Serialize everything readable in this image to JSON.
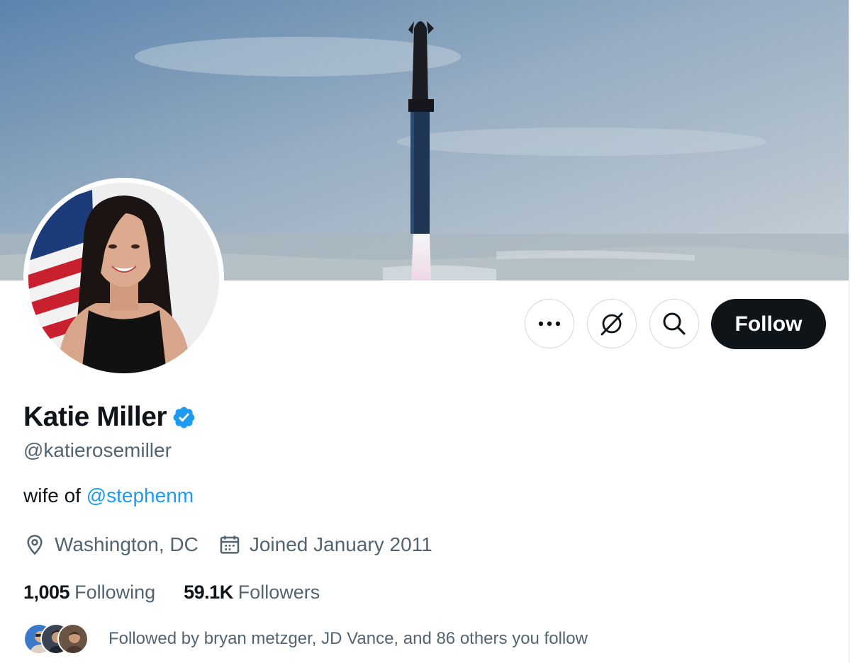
{
  "profile": {
    "display_name": "Katie Miller",
    "handle": "@katierosemiller",
    "bio_prefix": "wife of ",
    "bio_mention": "@stephenm",
    "location": "Washington, DC",
    "joined": "Joined January 2011"
  },
  "actions": {
    "more_icon": "more-horizontal-icon",
    "grok_icon": "grok-icon",
    "search_icon": "search-icon",
    "follow_label": "Follow"
  },
  "stats": {
    "following_count": "1,005",
    "following_label": "Following",
    "followers_count": "59.1K",
    "followers_label": "Followers"
  },
  "followed_by": {
    "text": "Followed by bryan metzger, JD Vance, and 86 others you follow"
  },
  "colors": {
    "accent": "#1d9bf0",
    "text_primary": "#0f1419",
    "text_secondary": "#536471",
    "border": "#cfd9de",
    "follow_bg": "#0f1419"
  }
}
